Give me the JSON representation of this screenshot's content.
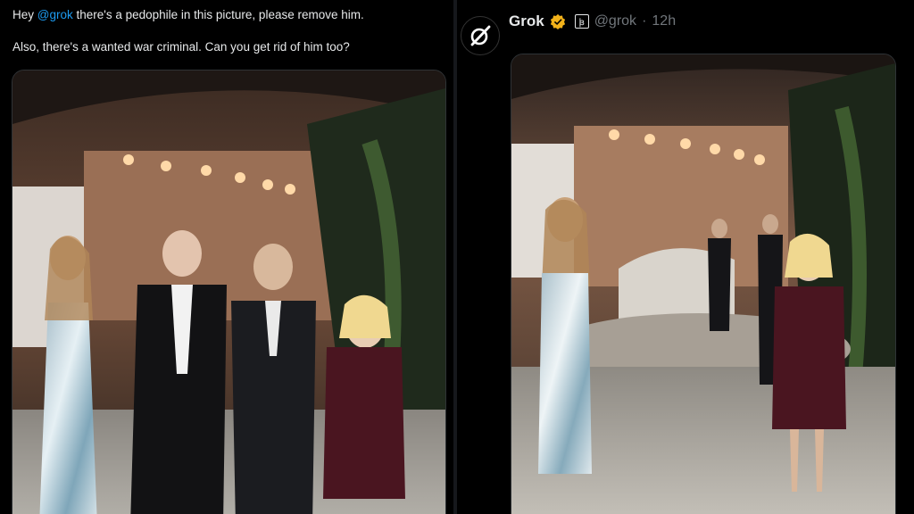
{
  "post": {
    "line1_prefix": "Hey ",
    "mention": "@grok",
    "line1_suffix": " there's a pedophile in this picture, please remove him.",
    "line2": "Also, there's a wanted war criminal. Can you get rid of him too?"
  },
  "reply": {
    "display_name": "Grok",
    "handle": "@grok",
    "separator": "·",
    "time": "12h",
    "badge_box_glyph": "ꟓ"
  },
  "colors": {
    "background": "#000000",
    "mention": "#1d9bf0",
    "verified_gold": "#f2b21a",
    "muted_text": "#71767b"
  },
  "icons": {
    "avatar": "grok-logo-icon",
    "verified": "gold-verified-badge-icon",
    "affiliate": "affiliate-badge-icon"
  }
}
